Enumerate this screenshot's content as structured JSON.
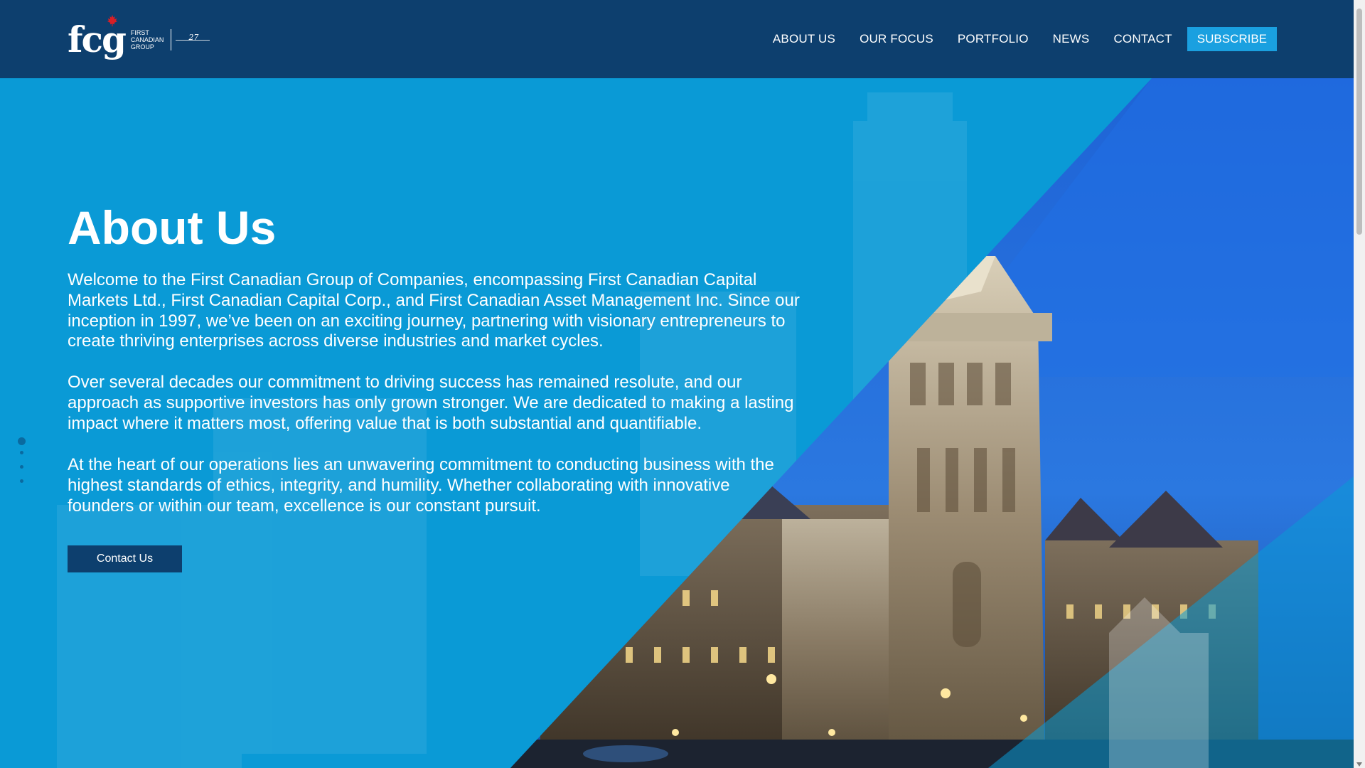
{
  "header": {
    "logo": {
      "mark": "fcg",
      "text_lines": [
        "FIRST",
        "CANADIAN",
        "GROUP"
      ],
      "years": "27"
    },
    "nav": [
      "ABOUT US",
      "OUR FOCUS",
      "PORTFOLIO",
      "NEWS",
      "CONTACT"
    ],
    "subscribe_label": "SUBSCRIBE"
  },
  "main": {
    "title": "About Us",
    "paragraphs": [
      "Welcome to the First Canadian Group of Companies, encompassing First Canadian Capital Markets Ltd., First Canadian Capital Corp., and First Canadian Asset Management Inc. Since our inception in 1997, we’ve been on an exciting journey, partnering with visionary entrepreneurs to create thriving enterprises across diverse industries and market cycles.",
      "Over several decades our commitment to driving success has remained resolute, and our approach as supportive investors has only grown stronger. We are dedicated to making a lasting impact where it matters most, offering value that is both substantial and quantifiable.",
      "At the heart of our operations lies an unwavering commitment to conducting business with the highest standards of ethics, integrity, and humility. Whether collaborating with innovative founders or within our team, excellence is our constant pursuit."
    ],
    "cta_label": "Contact Us"
  },
  "icons": {
    "maple": "maple-leaf-icon",
    "scroll_down": "chevron-down-icon"
  },
  "colors": {
    "header_bg": "#0d3f6e",
    "hero_bg": "#0a9ad6",
    "accent": "#1aa0e0",
    "cta_bg": "#0d3f6e"
  }
}
